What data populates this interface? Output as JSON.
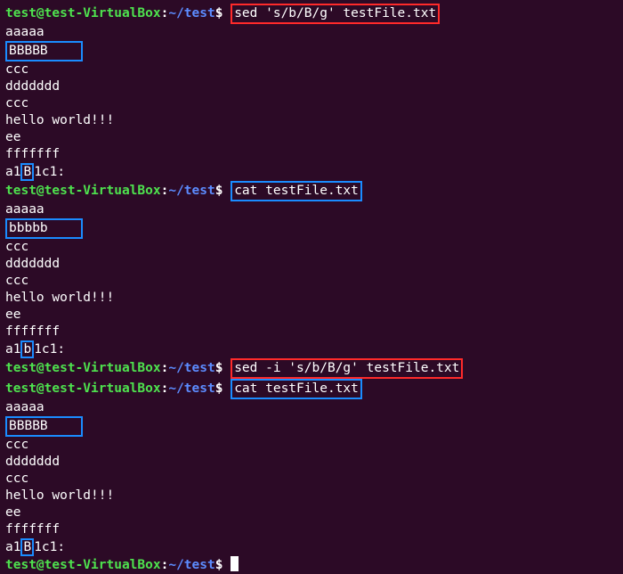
{
  "prompt": {
    "user": "test",
    "at": "@",
    "host": "test-VirtualBox",
    "colon": ":",
    "path": "~/test",
    "dollar": "$"
  },
  "cmd1": "sed 's/b/B/g' testFile.txt",
  "out1": {
    "l1": "aaaaa",
    "l2": "BBBBB",
    "l2pad": "    ",
    "l3": "ccc",
    "l4": "ddddddd",
    "l5": "ccc",
    "l6": "hello world!!!",
    "l7": "ee",
    "l8": "fffffff",
    "l9a": "a1",
    "l9b": "B",
    "l9c": "1c1:"
  },
  "cmd2": "cat testFile.txt",
  "out2": {
    "l1": "aaaaa",
    "l2": "bbbbb",
    "l2pad": "    ",
    "l3": "ccc",
    "l4": "ddddddd",
    "l5": "ccc",
    "l6": "hello world!!!",
    "l7": "ee",
    "l8": "fffffff",
    "l9a": "a1",
    "l9b": "b",
    "l9c": "1c1:"
  },
  "cmd3": "sed -i 's/b/B/g' testFile.txt",
  "cmd4": "cat testFile.txt",
  "out3": {
    "l1": "aaaaa",
    "l2": "BBBBB",
    "l2pad": "    ",
    "l3": "ccc",
    "l4": "ddddddd",
    "l5": "ccc",
    "l6": "hello world!!!",
    "l7": "ee",
    "l8": "fffffff",
    "l9a": "a1",
    "l9b": "B",
    "l9c": "1c1:"
  }
}
